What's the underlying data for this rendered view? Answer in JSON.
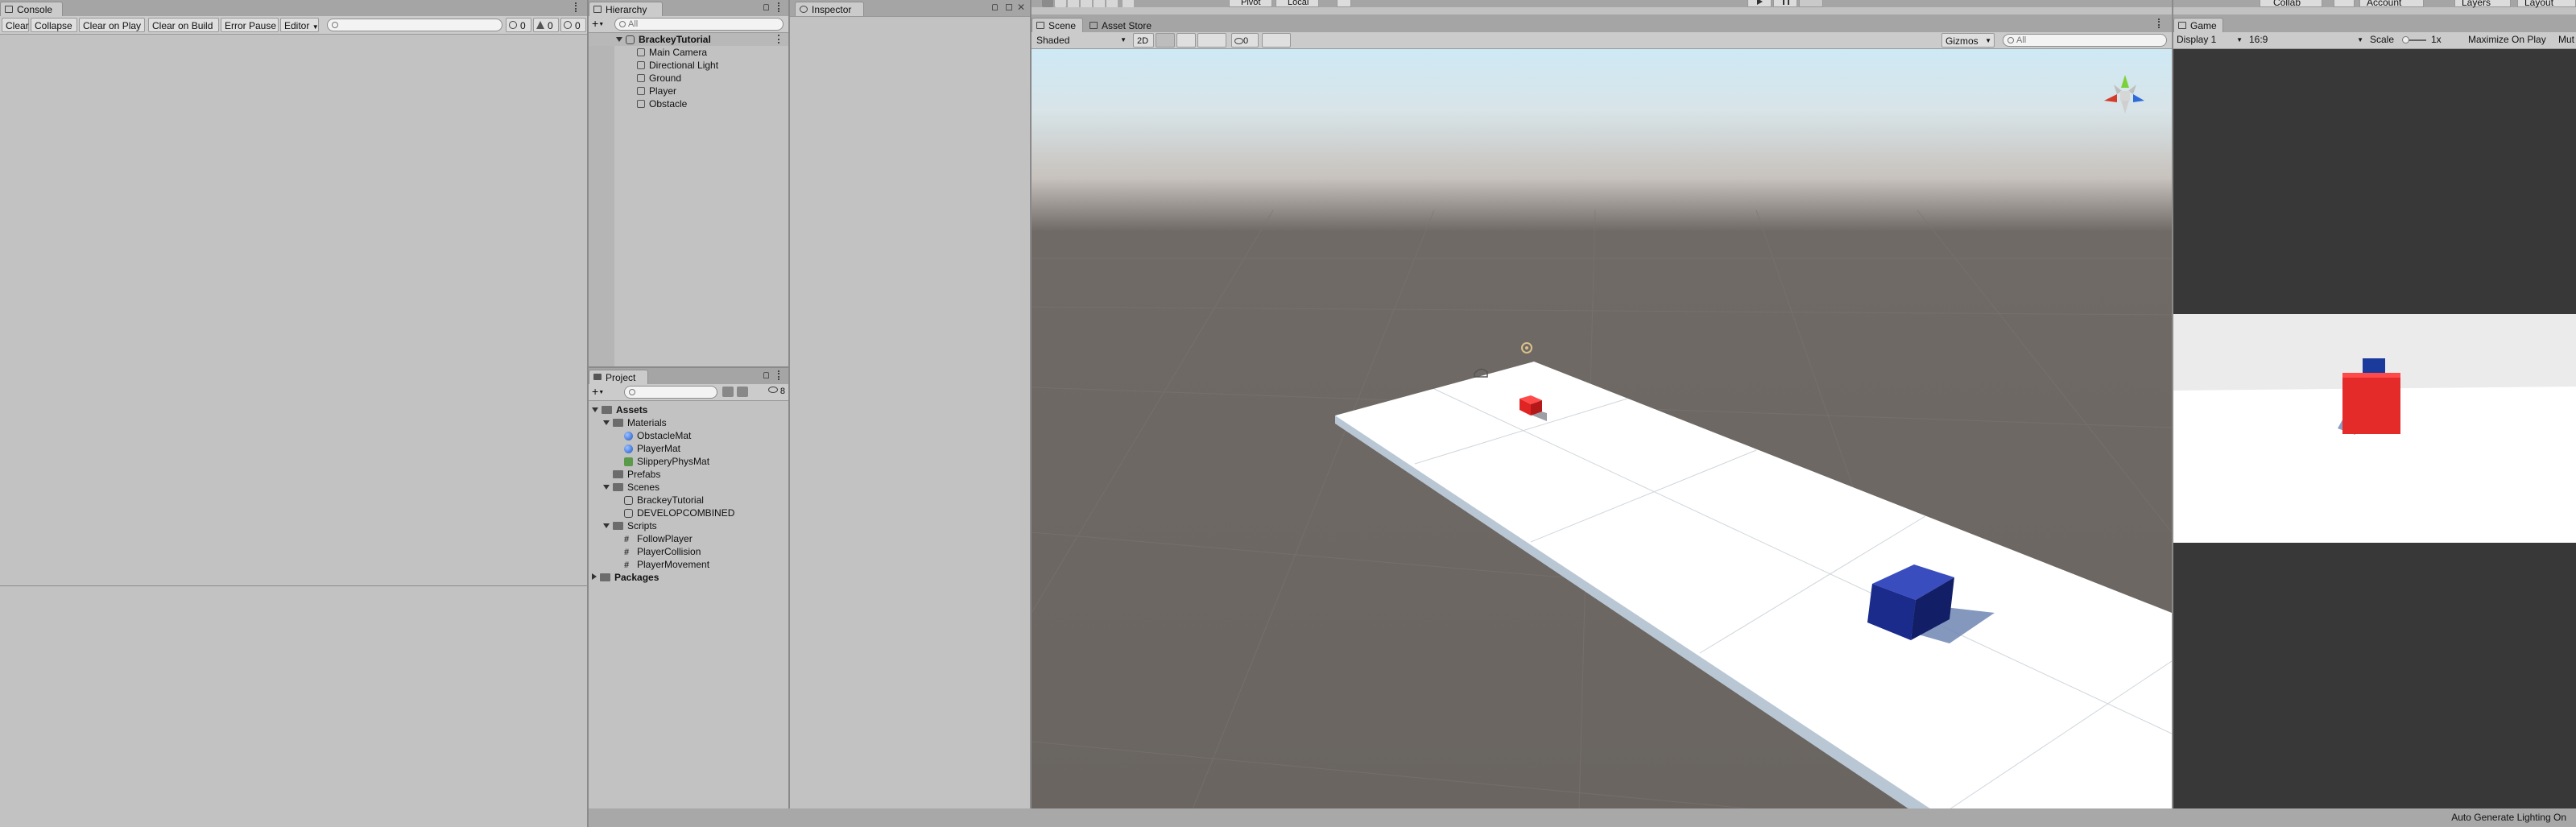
{
  "toolbar": {
    "pivot": "Pivot",
    "local": "Local",
    "collab": "Collab",
    "account": "Account",
    "layers": "Layers",
    "layout": "Layout"
  },
  "console": {
    "tab": "Console",
    "buttons": [
      "Clear",
      "Collapse",
      "Clear on Play",
      "Clear on Build",
      "Error Pause",
      "Editor"
    ],
    "counts": {
      "log": "0",
      "warn": "0",
      "error": "0"
    }
  },
  "hierarchy": {
    "tab": "Hierarchy",
    "search_placeholder": "All",
    "scene": "BrackeyTutorial",
    "objects": [
      "Main Camera",
      "Directional Light",
      "Ground",
      "Player",
      "Obstacle"
    ]
  },
  "inspector": {
    "tab": "Inspector"
  },
  "project": {
    "tab": "Project",
    "count": "8",
    "assets": "Assets",
    "materials": "Materials",
    "material_items": [
      "ObstacleMat",
      "PlayerMat",
      "SlipperyPhysMat"
    ],
    "prefabs": "Prefabs",
    "scenes": "Scenes",
    "scene_items": [
      "BrackeyTutorial",
      "DEVELOPCOMBINED"
    ],
    "scripts": "Scripts",
    "script_items": [
      "FollowPlayer",
      "PlayerCollision",
      "PlayerMovement"
    ],
    "packages": "Packages"
  },
  "scene_view": {
    "tabs": [
      "Scene",
      "Asset Store"
    ],
    "shading": "Shaded",
    "mode_2d": "2D",
    "hidden_count": "0",
    "gizmos": "Gizmos",
    "search_placeholder": "All"
  },
  "game_view": {
    "tab": "Game",
    "display": "Display 1",
    "aspect": "16:9",
    "scale_label": "Scale",
    "scale_value": "1x",
    "maximize": "Maximize On Play",
    "mute": "Mut"
  },
  "status": {
    "text": "Auto Generate Lighting On"
  },
  "colors": {
    "obstacle": "#e02323",
    "player": "#1a2b8c",
    "ground": "#ffffff",
    "sky": "#cfe9f5"
  }
}
